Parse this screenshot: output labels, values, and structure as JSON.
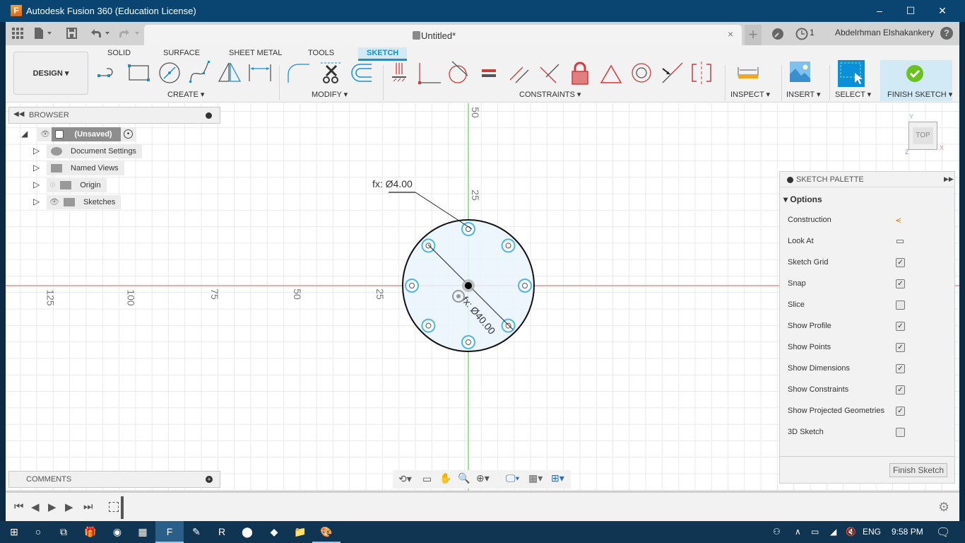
{
  "window": {
    "title": "Autodesk Fusion 360 (Education License)",
    "minimize": "–",
    "maximize": "☐",
    "close": "✕"
  },
  "quick_access": {
    "document_tab": "Untitled*",
    "tab_close": "×",
    "new_tab": "+",
    "job_count": "1",
    "user_name": "Abdelrhman Elshakankery",
    "help": "?"
  },
  "ribbon": {
    "workspace": "DESIGN ▾",
    "tabs": [
      {
        "label": "SOLID",
        "active": false
      },
      {
        "label": "SURFACE",
        "active": false
      },
      {
        "label": "SHEET METAL",
        "active": false
      },
      {
        "label": "TOOLS",
        "active": false
      },
      {
        "label": "SKETCH",
        "active": true
      }
    ],
    "groups": {
      "create": "CREATE ▾",
      "modify": "MODIFY ▾",
      "constraints": "CONSTRAINTS ▾",
      "inspect": "INSPECT ▾",
      "insert": "INSERT ▾",
      "select": "SELECT ▾",
      "finish": "FINISH SKETCH ▾"
    },
    "create_tools": [
      "line-icon",
      "rectangle-icon",
      "circle-icon",
      "spline-icon",
      "mirror-icon",
      "sketch-dimension-icon"
    ],
    "modify_tools": [
      "fillet-icon",
      "trim-icon",
      "offset-icon"
    ],
    "constraint_tools": [
      "horizontal-vertical-icon",
      "coincident-icon",
      "tangent-icon",
      "equal-icon",
      "parallel-icon",
      "perpendicular-icon",
      "fix-icon",
      "midpoint-icon",
      "concentric-icon",
      "collinear-icon",
      "symmetry-icon"
    ]
  },
  "browser": {
    "title": "BROWSER",
    "root": "(Unsaved)",
    "items": [
      {
        "label": "Document Settings",
        "icon": "gear-icon"
      },
      {
        "label": "Named Views",
        "icon": "folder-icon"
      },
      {
        "label": "Origin",
        "icon": "folder-icon",
        "visible": false
      },
      {
        "label": "Sketches",
        "icon": "folder-icon",
        "visible": true
      }
    ]
  },
  "comments": {
    "title": "COMMENTS"
  },
  "canvas": {
    "horizontal_ticks": [
      "125",
      "100",
      "75",
      "50",
      "25"
    ],
    "vertical_ticks": [
      "50",
      "25"
    ],
    "dimension_small": "fx: Ø4.00",
    "dimension_large": "fx: Ø40.00",
    "viewcube": {
      "face": "TOP",
      "x": "X",
      "y": "Y",
      "z": "Z"
    }
  },
  "sketch_palette": {
    "title": "SKETCH PALETTE",
    "section": "Options",
    "options": [
      {
        "label": "Construction",
        "type": "icon"
      },
      {
        "label": "Look At",
        "type": "icon"
      },
      {
        "label": "Sketch Grid",
        "checked": true
      },
      {
        "label": "Snap",
        "checked": true
      },
      {
        "label": "Slice",
        "checked": false
      },
      {
        "label": "Show Profile",
        "checked": true
      },
      {
        "label": "Show Points",
        "checked": true
      },
      {
        "label": "Show Dimensions",
        "checked": true
      },
      {
        "label": "Show Constraints",
        "checked": true
      },
      {
        "label": "Show Projected Geometries",
        "checked": true
      },
      {
        "label": "3D Sketch",
        "checked": false
      }
    ],
    "finish_button": "Finish Sketch"
  },
  "taskbar": {
    "language": "ENG",
    "time": "9:58 PM"
  },
  "colors": {
    "accent": "#0696d7",
    "title_bar": "#0a4470",
    "constraint_red": "#d03a3a",
    "finish_green": "#6ac31c",
    "x_axis": "#f2a0a0",
    "y_axis": "#8fdc8f"
  }
}
